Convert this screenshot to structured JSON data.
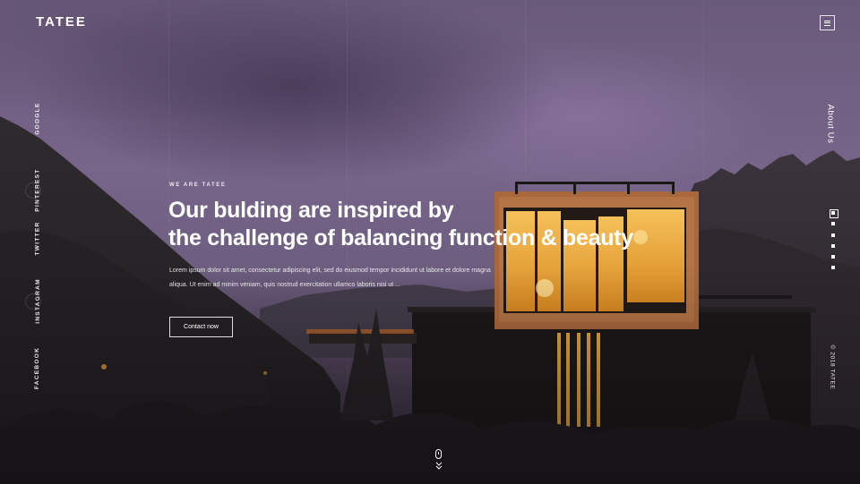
{
  "brand": {
    "logo": "TATEE"
  },
  "header": {
    "menu_icon": "hamburger-icon"
  },
  "social": [
    {
      "label": "GOOGLE"
    },
    {
      "label": "PINTEREST"
    },
    {
      "label": "TWITTER"
    },
    {
      "label": "INSTAGRAM"
    },
    {
      "label": "FACEBOOK"
    }
  ],
  "hero": {
    "eyebrow": "WE ARE TATEE",
    "headline_line1": "Our bulding are inspired by",
    "headline_line2": "the challenge of balancing function & beauty",
    "body_line1": "Lorem ipsum dolor sit amet, consectetur adipiscing elit, sed do eiusmod tempor incididunt ut labore et dolore magna",
    "body_line2": "aliqua. Ut enim ad minim veniam, quis nostrud exercitation ullamco laboris nisi ut ...",
    "cta_label": "Contact now"
  },
  "right_nav": {
    "about_label": "About Us",
    "slide_count": 6,
    "active_slide": 1,
    "copyright": "© 2018 TATEE"
  },
  "scroll_indicator": {
    "icon": "mouse-scroll-icon"
  },
  "colors": {
    "sky": "#77658a",
    "window_glow": "#f2a93a",
    "text": "#ffffff"
  }
}
